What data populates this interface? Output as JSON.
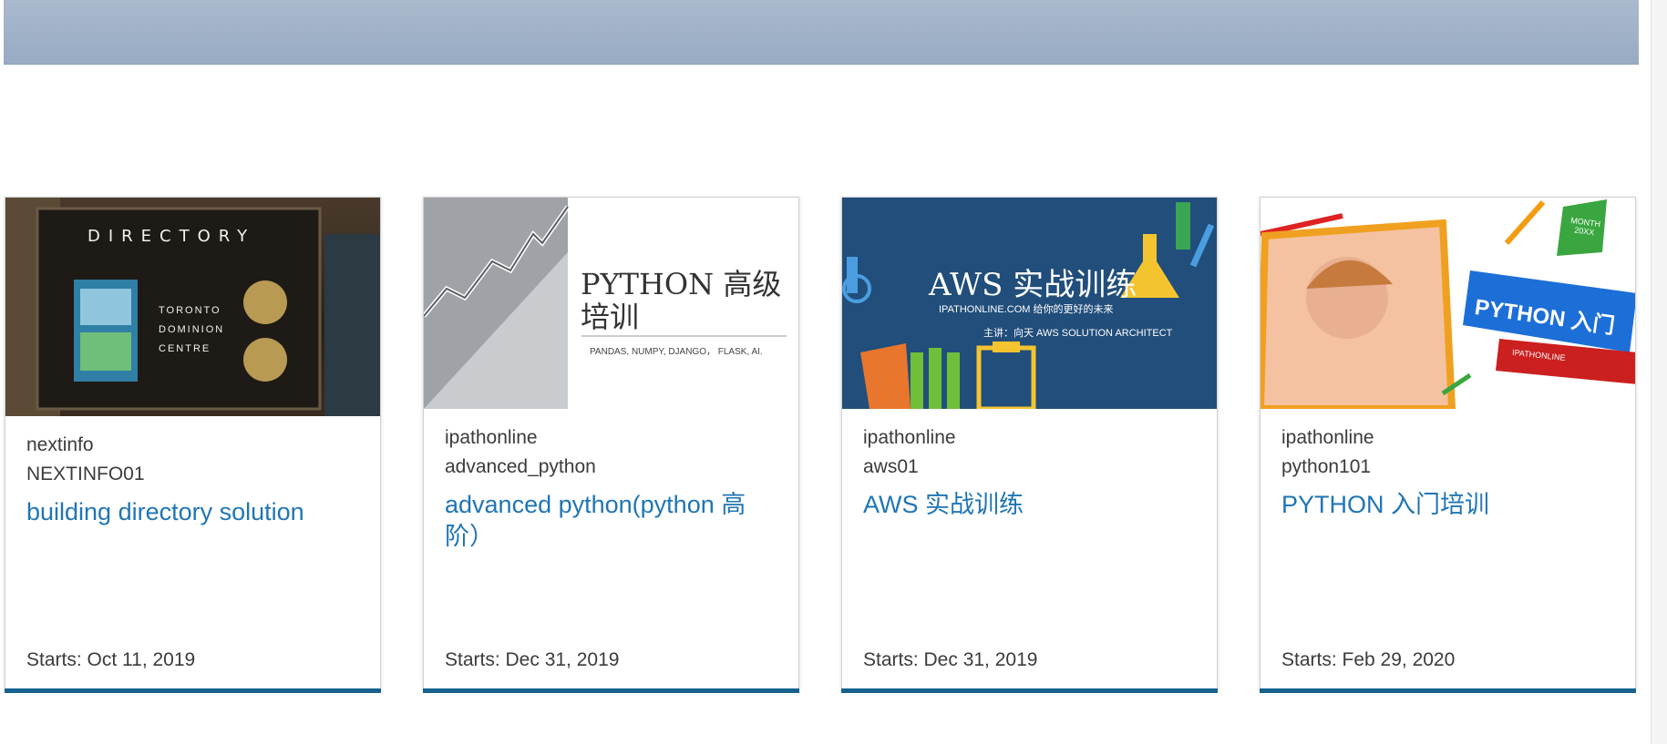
{
  "colors": {
    "accent_bar": "#15628e",
    "title_link": "#1f75b5",
    "aws_bg": "#214e7b"
  },
  "courses": [
    {
      "org": "nextinfo",
      "number": "NEXTINFO01",
      "title": "building directory solution",
      "start_label": "Starts: Oct 11, 2019",
      "image": {
        "heading": "DIRECTORY",
        "lines": [
          "TORONTO",
          "DOMINION",
          "CENTRE"
        ]
      }
    },
    {
      "org": "ipathonline",
      "number": "advanced_python",
      "title": "advanced python(python 高阶）",
      "start_label": "Starts: Dec 31, 2019",
      "image": {
        "heading_line1": "PYTHON 高级",
        "heading_line2": "培训",
        "subtitle": "PANDAS, NUMPY, DJANGO， FLASK, AI."
      }
    },
    {
      "org": "ipathonline",
      "number": "aws01",
      "title": "AWS 实战训练",
      "start_label": "Starts: Dec 31, 2019",
      "image": {
        "heading": "AWS 实战训练",
        "subtitle": "IPATHONLINE.COM 给你的更好的未来",
        "speaker": "主讲：向天    AWS SOLUTION ARCHITECT"
      }
    },
    {
      "org": "ipathonline",
      "number": "python101",
      "title": "PYTHON 入门培训",
      "start_label": "Starts: Feb 29, 2020",
      "image": {
        "banner": "PYTHON 入门",
        "badge": "MONTH 20XX",
        "ribbon": "IPATHONLINE"
      }
    }
  ]
}
